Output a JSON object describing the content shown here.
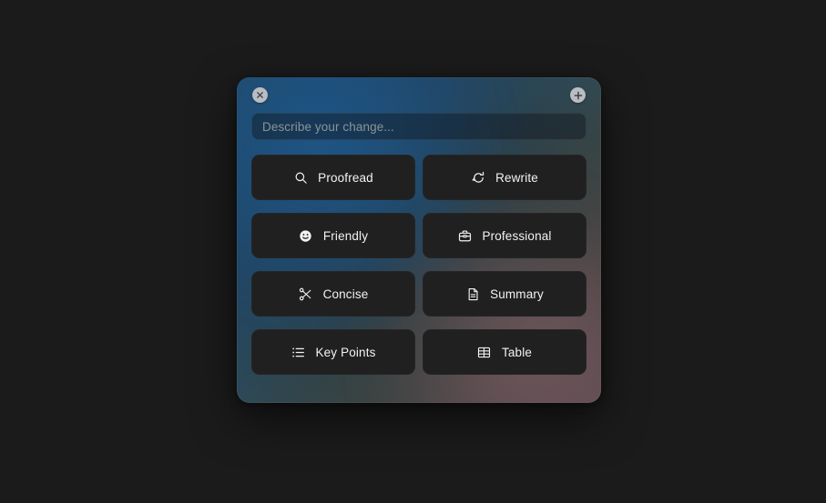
{
  "panel": {
    "name": "ai-writing-assistant-popover",
    "close_button": {
      "label": "Close",
      "icon": "close-icon"
    },
    "add_button": {
      "label": "Add",
      "icon": "plus-icon"
    },
    "accent_colors": {
      "panel_gradient_start": "#1d4a6b",
      "panel_gradient_mid": "#3b4a4a",
      "panel_gradient_end": "#514247",
      "button_background": "#202021",
      "text_primary": "#f2f3f4",
      "text_placeholder": "#8b939a",
      "corner_button_background": "#b9bcc0"
    }
  },
  "prompt": {
    "placeholder": "Describe your change...",
    "value": ""
  },
  "actions": [
    {
      "id": "proofread",
      "label": "Proofread",
      "icon": "search-icon"
    },
    {
      "id": "rewrite",
      "label": "Rewrite",
      "icon": "refresh-icon"
    },
    {
      "id": "friendly",
      "label": "Friendly",
      "icon": "smiley-face-icon"
    },
    {
      "id": "professional",
      "label": "Professional",
      "icon": "briefcase-icon"
    },
    {
      "id": "concise",
      "label": "Concise",
      "icon": "scissors-icon"
    },
    {
      "id": "summary",
      "label": "Summary",
      "icon": "document-icon"
    },
    {
      "id": "key-points",
      "label": "Key Points",
      "icon": "bullet-list-icon"
    },
    {
      "id": "table",
      "label": "Table",
      "icon": "table-grid-icon"
    }
  ]
}
